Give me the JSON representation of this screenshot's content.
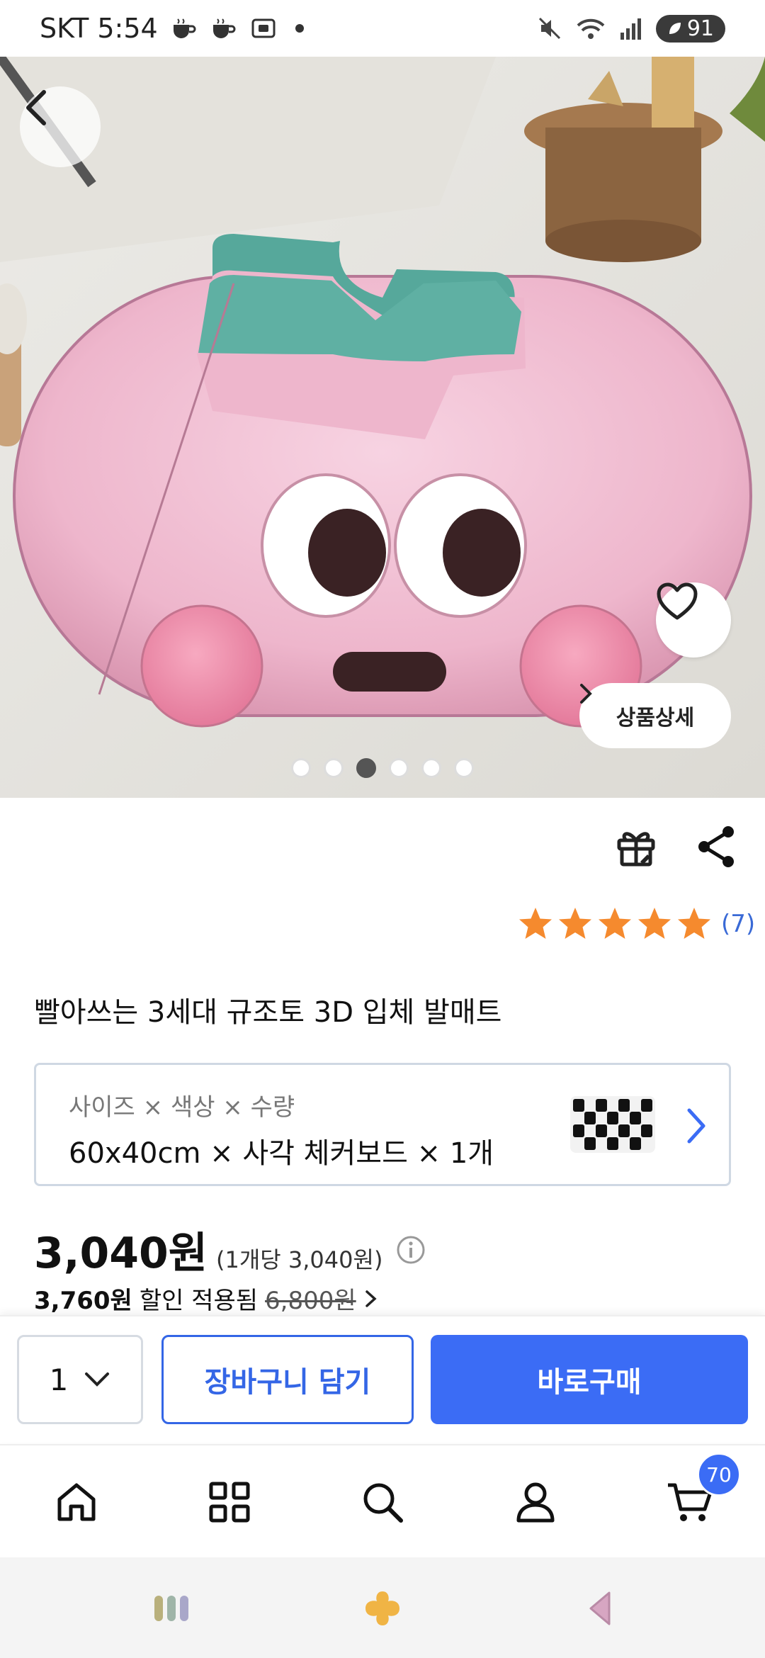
{
  "status_bar": {
    "carrier_time": "SKT 5:54",
    "battery": "91"
  },
  "hero": {
    "image_name": "3D peach face foot mat",
    "detail_label": "상품상세",
    "slide_count": 6,
    "active_slide_index": 2
  },
  "rating": {
    "stars": 5,
    "count": "(7)",
    "star_color": "#f58a2e"
  },
  "product": {
    "title": "빨아쓰는 3세대 규조토 3D 입체 발매트"
  },
  "option": {
    "label": "사이즈 × 색상 × 수량",
    "value": "60x40cm × 사각 체커보드 × 1개"
  },
  "price": {
    "main": "3,040원",
    "unit_price": "(1개당 3,040원)",
    "discounted": "3,760원",
    "discount_note": "할인 적용됨",
    "original": "6,800원"
  },
  "purchase": {
    "quantity": "1",
    "add_to_cart": "장바구니 담기",
    "buy_now": "바로구매",
    "accent": "#3b6cf5"
  },
  "bottom_nav": {
    "items": [
      "home-icon",
      "category-icon",
      "search-icon",
      "profile-icon",
      "cart-icon"
    ],
    "cart_badge": "70"
  }
}
